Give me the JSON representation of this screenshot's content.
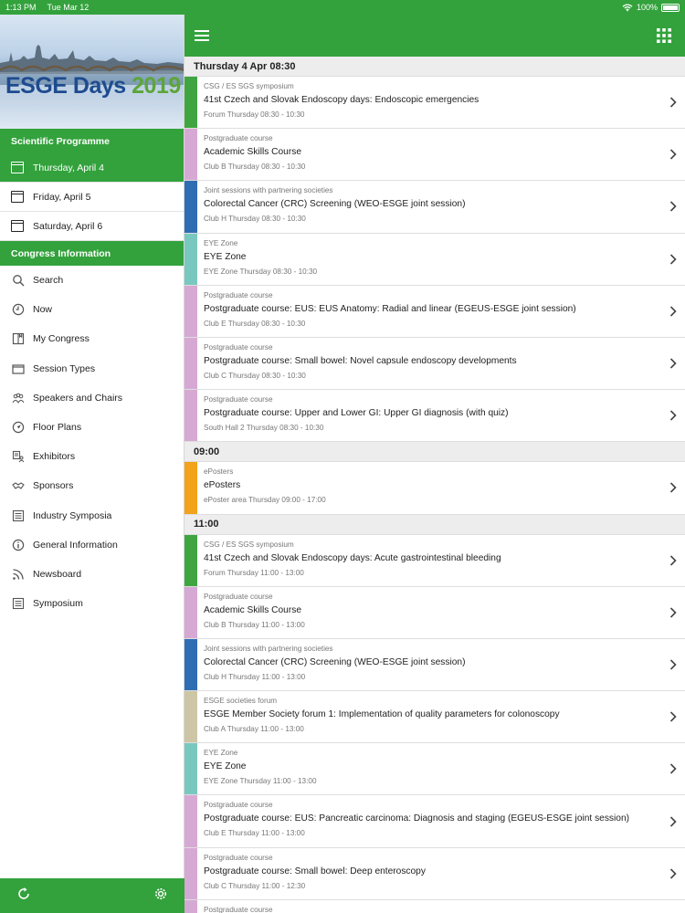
{
  "status": {
    "time": "1:13 PM",
    "date": "Tue Mar 12",
    "battery": "100%"
  },
  "sidebar": {
    "logo_text": "ESGE Days",
    "logo_year": "2019",
    "programme_header": "Scientific Programme",
    "days": [
      {
        "label": "Thursday, April 4",
        "active": true
      },
      {
        "label": "Friday, April 5",
        "active": false
      },
      {
        "label": "Saturday, April 6",
        "active": false
      }
    ],
    "congress_header": "Congress Information",
    "menu": [
      {
        "label": "Search",
        "icon": "search-icon"
      },
      {
        "label": "Now",
        "icon": "clock-icon"
      },
      {
        "label": "My Congress",
        "icon": "bookmark-book-icon"
      },
      {
        "label": "Session Types",
        "icon": "folder-icon"
      },
      {
        "label": "Speakers and Chairs",
        "icon": "people-icon"
      },
      {
        "label": "Floor Plans",
        "icon": "navigation-icon"
      },
      {
        "label": "Exhibitors",
        "icon": "exhibitor-icon"
      },
      {
        "label": "Sponsors",
        "icon": "handshake-icon"
      },
      {
        "label": "Industry Symposia",
        "icon": "list-icon"
      },
      {
        "label": "General Information",
        "icon": "info-icon"
      },
      {
        "label": "Newsboard",
        "icon": "rss-icon"
      },
      {
        "label": "Symposium",
        "icon": "list-icon"
      }
    ]
  },
  "colors": {
    "brand_green": "#33a23c",
    "csg": "#3fa540",
    "postgraduate": "#d6a9d4",
    "joint": "#2f6db3",
    "eye": "#79c8c0",
    "eposter": "#f2a21b",
    "societies": "#cdc6a6"
  },
  "groups": [
    {
      "header": "Thursday 4 Apr 08:30",
      "sessions": [
        {
          "color": "csg",
          "category": "CSG / ES SGS symposium",
          "title": "41st Czech and Slovak Endoscopy days: Endoscopic emergencies",
          "meta": "Forum Thursday 08:30 - 10:30"
        },
        {
          "color": "postgraduate",
          "category": "Postgraduate course",
          "title": "Academic Skills Course",
          "meta": "Club B Thursday 08:30 - 10:30"
        },
        {
          "color": "joint",
          "category": "Joint sessions with partnering societies",
          "title": "Colorectal Cancer (CRC) Screening (WEO-ESGE joint session)",
          "meta": "Club H Thursday 08:30 - 10:30"
        },
        {
          "color": "eye",
          "category": "EYE Zone",
          "title": "EYE Zone",
          "meta": "EYE Zone Thursday 08:30 - 10:30"
        },
        {
          "color": "postgraduate",
          "category": "Postgraduate course",
          "title": "Postgraduate course: EUS: EUS Anatomy: Radial and linear (EGEUS-ESGE joint session)",
          "meta": "Club E Thursday 08:30 - 10:30"
        },
        {
          "color": "postgraduate",
          "category": "Postgraduate course",
          "title": "Postgraduate course: Small bowel: Novel capsule endoscopy developments",
          "meta": "Club C Thursday 08:30 - 10:30"
        },
        {
          "color": "postgraduate",
          "category": "Postgraduate course",
          "title": "Postgraduate course: Upper and Lower GI: Upper GI diagnosis (with quiz)",
          "meta": "South Hall 2 Thursday 08:30 - 10:30"
        }
      ]
    },
    {
      "header": "09:00",
      "sessions": [
        {
          "color": "eposter",
          "category": "ePosters",
          "title": "ePosters",
          "meta": "ePoster area Thursday 09:00 - 17:00"
        }
      ]
    },
    {
      "header": "11:00",
      "sessions": [
        {
          "color": "csg",
          "category": "CSG / ES SGS symposium",
          "title": "41st Czech and Slovak Endoscopy days: Acute gastrointestinal bleeding",
          "meta": "Forum Thursday 11:00 - 13:00"
        },
        {
          "color": "postgraduate",
          "category": "Postgraduate course",
          "title": "Academic Skills Course",
          "meta": "Club B Thursday 11:00 - 13:00"
        },
        {
          "color": "joint",
          "category": "Joint sessions with partnering societies",
          "title": "Colorectal Cancer (CRC) Screening (WEO-ESGE joint session)",
          "meta": "Club H Thursday 11:00 - 13:00"
        },
        {
          "color": "societies",
          "category": "ESGE societies forum",
          "title": "ESGE Member Society forum 1: Implementation of quality parameters for colonoscopy",
          "meta": "Club A Thursday 11:00 - 13:00"
        },
        {
          "color": "eye",
          "category": "EYE Zone",
          "title": "EYE Zone",
          "meta": "EYE Zone Thursday 11:00 - 13:00"
        },
        {
          "color": "postgraduate",
          "category": "Postgraduate course",
          "title": "Postgraduate course: EUS: Pancreatic carcinoma: Diagnosis and staging (EGEUS-ESGE joint session)",
          "meta": "Club E Thursday 11:00 - 13:00"
        },
        {
          "color": "postgraduate",
          "category": "Postgraduate course",
          "title": "Postgraduate course: Small bowel: Deep enteroscopy",
          "meta": "Club C Thursday 11:00 - 12:30"
        },
        {
          "color": "postgraduate",
          "category": "Postgraduate course",
          "title": "",
          "meta": ""
        }
      ]
    }
  ]
}
